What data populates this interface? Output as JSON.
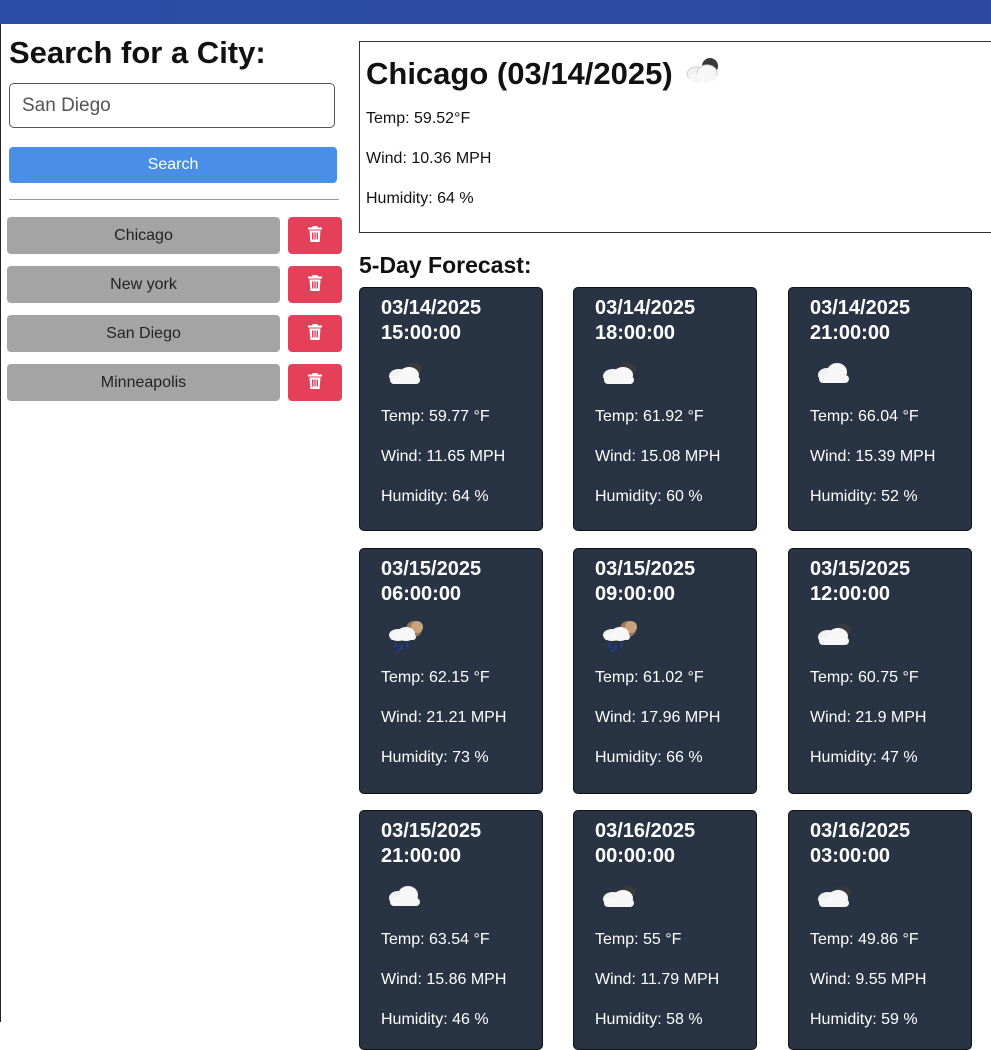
{
  "search": {
    "title": "Search for a City:",
    "input_value": "San Diego",
    "button_label": "Search"
  },
  "history": [
    {
      "city": "Chicago"
    },
    {
      "city": "New york"
    },
    {
      "city": "San Diego"
    },
    {
      "city": "Minneapolis"
    }
  ],
  "current": {
    "title": "Chicago (03/14/2025)",
    "icon": "few-clouds-icon",
    "temp": "Temp: 59.52°F",
    "wind": "Wind: 10.36 MPH",
    "humidity": "Humidity: 64 %"
  },
  "forecast_title": "5-Day Forecast:",
  "forecast": [
    {
      "date": "03/14/2025",
      "time": "15:00:00",
      "icon": "few-clouds-icon",
      "temp": "Temp: 59.77 °F",
      "wind": "Wind: 11.65 MPH",
      "humidity": "Humidity: 64 %"
    },
    {
      "date": "03/14/2025",
      "time": "18:00:00",
      "icon": "few-clouds-icon",
      "temp": "Temp: 61.92 °F",
      "wind": "Wind: 15.08 MPH",
      "humidity": "Humidity: 60 %"
    },
    {
      "date": "03/14/2025",
      "time": "21:00:00",
      "icon": "cloud-icon",
      "temp": "Temp: 66.04 °F",
      "wind": "Wind: 15.39 MPH",
      "humidity": "Humidity: 52 %"
    },
    {
      "date": "03/15/2025",
      "time": "06:00:00",
      "icon": "rain-night-icon",
      "temp": "Temp: 62.15 °F",
      "wind": "Wind: 21.21 MPH",
      "humidity": "Humidity: 73 %"
    },
    {
      "date": "03/15/2025",
      "time": "09:00:00",
      "icon": "rain-night-icon",
      "temp": "Temp: 61.02 °F",
      "wind": "Wind: 17.96 MPH",
      "humidity": "Humidity: 66 %"
    },
    {
      "date": "03/15/2025",
      "time": "12:00:00",
      "icon": "few-clouds-icon",
      "temp": "Temp: 60.75 °F",
      "wind": "Wind: 21.9 MPH",
      "humidity": "Humidity: 47 %"
    },
    {
      "date": "03/15/2025",
      "time": "21:00:00",
      "icon": "cloud-icon",
      "temp": "Temp: 63.54 °F",
      "wind": "Wind: 15.86 MPH",
      "humidity": "Humidity: 46 %"
    },
    {
      "date": "03/16/2025",
      "time": "00:00:00",
      "icon": "few-clouds-icon",
      "temp": "Temp: 55 °F",
      "wind": "Wind: 11.79 MPH",
      "humidity": "Humidity: 58 %"
    },
    {
      "date": "03/16/2025",
      "time": "03:00:00",
      "icon": "few-clouds-icon",
      "temp": "Temp: 49.86 °F",
      "wind": "Wind: 9.55 MPH",
      "humidity": "Humidity: 59 %"
    }
  ],
  "colors": {
    "header": "#2c4ca2",
    "search_button": "#4a8fe7",
    "city_button": "#a4a4a4",
    "delete_button": "#e5405a",
    "card_bg": "#283444"
  }
}
